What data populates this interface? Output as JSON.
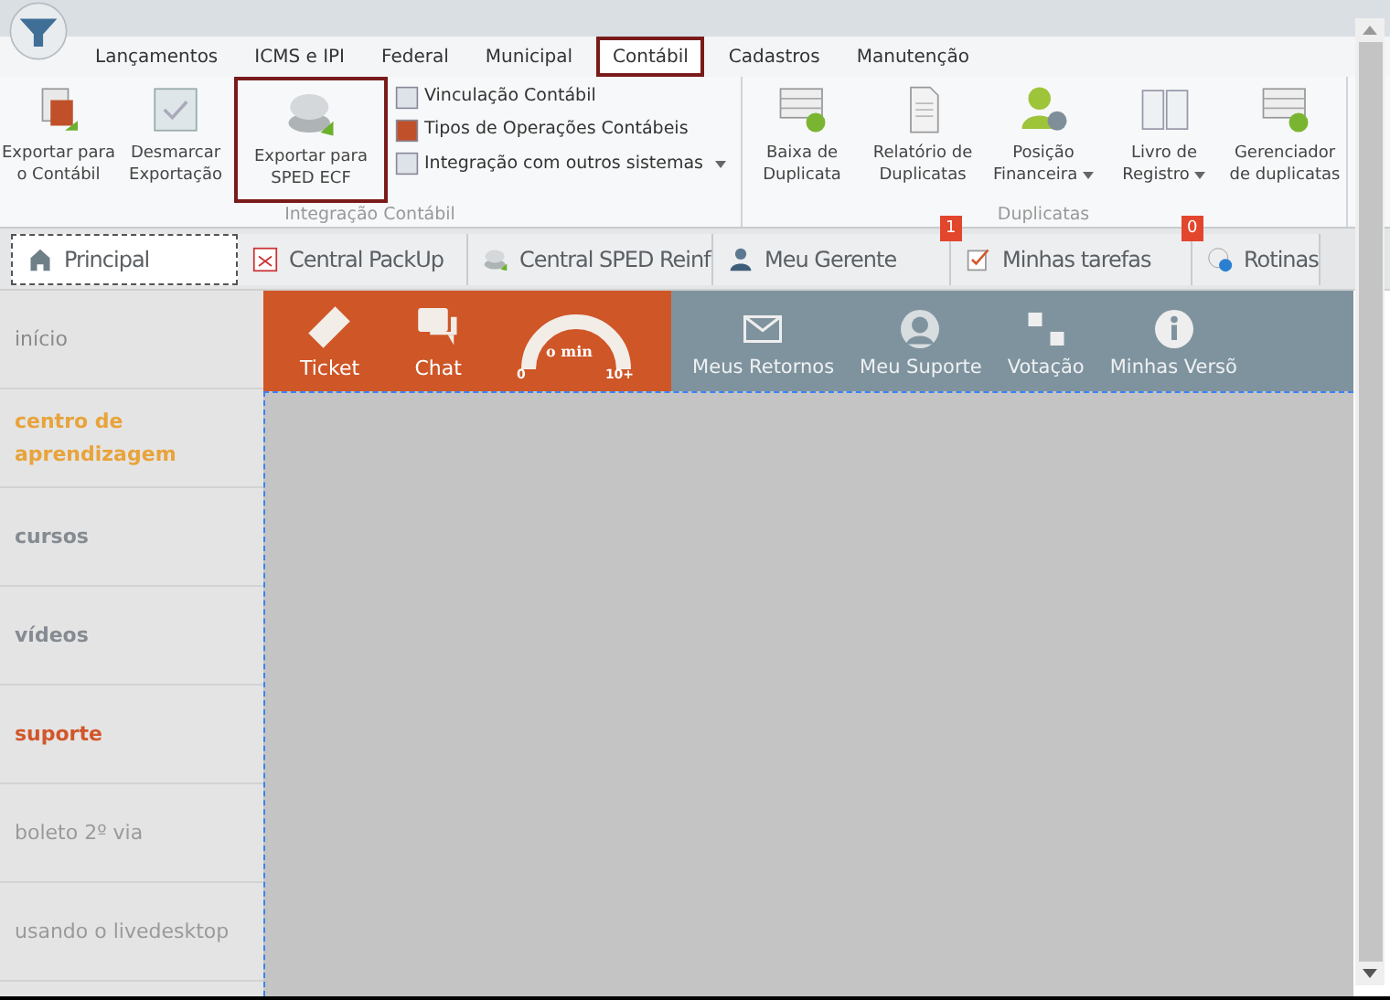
{
  "menu_tabs": [
    {
      "label": "Lançamentos",
      "selected": false
    },
    {
      "label": "ICMS e IPI",
      "selected": false
    },
    {
      "label": "Federal",
      "selected": false
    },
    {
      "label": "Municipal",
      "selected": false
    },
    {
      "label": "Contábil",
      "selected": true
    },
    {
      "label": "Cadastros",
      "selected": false
    },
    {
      "label": "Manutenção",
      "selected": false
    }
  ],
  "ribbon_groups": [
    {
      "title": "Integração Contábil",
      "large_buttons": [
        {
          "label": "Exportar para o Contábil",
          "highlighted": false
        },
        {
          "label": "Desmarcar Exportação",
          "highlighted": false
        },
        {
          "label": "Exportar para SPED ECF",
          "highlighted": true
        }
      ],
      "small_buttons": [
        {
          "label": "Vinculação Contábil",
          "dropdown": false
        },
        {
          "label": "Tipos de Operações Contábeis",
          "dropdown": false
        },
        {
          "label": "Integração com outros sistemas",
          "dropdown": true
        }
      ]
    },
    {
      "title": "Duplicatas",
      "large_buttons": [
        {
          "label": "Baixa de Duplicata",
          "highlighted": false,
          "dropdown": false
        },
        {
          "label": "Relatório de Duplicatas",
          "highlighted": false,
          "dropdown": false
        },
        {
          "label": "Posição Financeira",
          "highlighted": false,
          "dropdown": true
        },
        {
          "label": "Livro de Registro",
          "highlighted": false,
          "dropdown": true
        },
        {
          "label": "Gerenciador de duplicatas",
          "highlighted": false,
          "dropdown": false
        }
      ]
    }
  ],
  "doc_tabs": [
    {
      "label": "Principal",
      "selected": true
    },
    {
      "label": "Central PackUp",
      "selected": false
    },
    {
      "label": "Central SPED Reinf",
      "selected": false
    },
    {
      "label": "Meu Gerente",
      "selected": false
    },
    {
      "label": "Minhas tarefas",
      "selected": false,
      "badge": "1"
    },
    {
      "label": "Rotinas",
      "selected": false,
      "badge": "0"
    }
  ],
  "sidebar": {
    "items": [
      {
        "label": "início",
        "kind": "plain",
        "color": "#8a8a8a"
      },
      {
        "label": "centro de aprendizagem",
        "kind": "bold",
        "color": "#e8a33a"
      },
      {
        "label": "cursos",
        "kind": "bold",
        "color": "#858b92"
      },
      {
        "label": "vídeos",
        "kind": "bold",
        "color": "#858b92"
      },
      {
        "label": "suporte",
        "kind": "bold",
        "color": "#d2562a"
      },
      {
        "label": "boleto 2º via",
        "kind": "plain",
        "color": "#9a9a9a"
      },
      {
        "label": "usando o livedesktop",
        "kind": "plain",
        "color": "#9a9a9a"
      }
    ]
  },
  "support_bar": {
    "orange": [
      "Ticket",
      "Chat"
    ],
    "gauge": {
      "caption": "o min",
      "min": "0",
      "max": "10+"
    },
    "grey": [
      "Meus Retornos",
      "Meu Suporte",
      "Votação",
      "Minhas Versõ"
    ]
  }
}
